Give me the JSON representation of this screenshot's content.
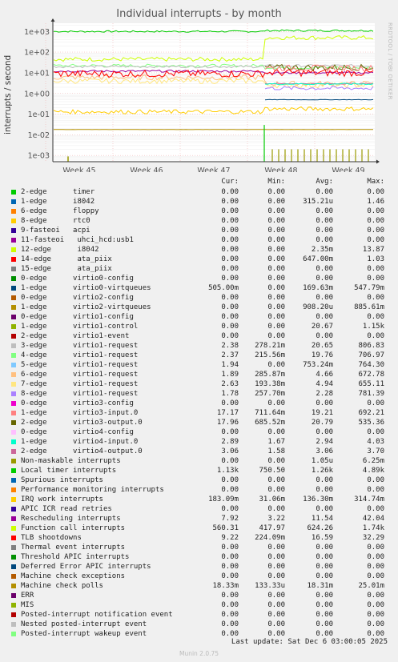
{
  "side_label": "RRDTOOL / TOBI OETIKER",
  "version": "Munin 2.0.75",
  "last_update": "Last update: Sat Dec  6 03:00:05 2025",
  "legend_headers": [
    "Cur:",
    "Min:",
    "Avg:",
    "Max:"
  ],
  "chart_data": {
    "type": "line",
    "title": "Individual interrupts - by month",
    "ylabel": "interrupts / second",
    "yscale": "log",
    "ylim": [
      0.0005,
      2500
    ],
    "yticks": [
      "1e+03",
      "1e+02",
      "1e+01",
      "1e+00",
      "1e-01",
      "1e-02",
      "1e-03"
    ],
    "x_tick_labels": [
      "Week 45",
      "Week 46",
      "Week 47",
      "Week 48",
      "Week 49"
    ],
    "grid": true,
    "series": [
      {
        "name": "2-edge      timer",
        "color": "#00cc00",
        "cur": "0.00",
        "min": "0.00",
        "avg": "0.00",
        "max": "0.00"
      },
      {
        "name": "1-edge      i8042",
        "color": "#0066b3",
        "cur": "0.00",
        "min": "0.00",
        "avg": "315.21u",
        "max": "1.46"
      },
      {
        "name": "6-edge      floppy",
        "color": "#ff8000",
        "cur": "0.00",
        "min": "0.00",
        "avg": "0.00",
        "max": "0.00"
      },
      {
        "name": "8-edge      rtc0",
        "color": "#ffcc00",
        "cur": "0.00",
        "min": "0.00",
        "avg": "0.00",
        "max": "0.00"
      },
      {
        "name": "9-fasteoi   acpi",
        "color": "#330099",
        "cur": "0.00",
        "min": "0.00",
        "avg": "0.00",
        "max": "0.00"
      },
      {
        "name": "11-fasteoi   uhci_hcd:usb1",
        "color": "#990099",
        "cur": "0.00",
        "min": "0.00",
        "avg": "0.00",
        "max": "0.00"
      },
      {
        "name": "12-edge      i8042",
        "color": "#ccff00",
        "cur": "0.00",
        "min": "0.00",
        "avg": "2.35m",
        "max": "13.87"
      },
      {
        "name": "14-edge      ata_piix",
        "color": "#ff0000",
        "cur": "0.00",
        "min": "0.00",
        "avg": "647.00m",
        "max": "1.03"
      },
      {
        "name": "15-edge      ata_piix",
        "color": "#808080",
        "cur": "0.00",
        "min": "0.00",
        "avg": "0.00",
        "max": "0.00"
      },
      {
        "name": "0-edge      virtio0-config",
        "color": "#008f00",
        "cur": "0.00",
        "min": "0.00",
        "avg": "0.00",
        "max": "0.00"
      },
      {
        "name": "1-edge      virtio0-virtqueues",
        "color": "#00487d",
        "cur": "505.00m",
        "min": "0.00",
        "avg": "169.63m",
        "max": "547.79m"
      },
      {
        "name": "0-edge      virtio2-config",
        "color": "#b35a00",
        "cur": "0.00",
        "min": "0.00",
        "avg": "0.00",
        "max": "0.00"
      },
      {
        "name": "1-edge      virtio2-virtqueues",
        "color": "#b38f00",
        "cur": "0.00",
        "min": "0.00",
        "avg": "908.20u",
        "max": "885.61m"
      },
      {
        "name": "0-edge      virtio1-config",
        "color": "#6b006b",
        "cur": "0.00",
        "min": "0.00",
        "avg": "0.00",
        "max": "0.00"
      },
      {
        "name": "1-edge      virtio1-control",
        "color": "#8fb300",
        "cur": "0.00",
        "min": "0.00",
        "avg": "20.67",
        "max": "1.15k"
      },
      {
        "name": "2-edge      virtio1-event",
        "color": "#b30000",
        "cur": "0.00",
        "min": "0.00",
        "avg": "0.00",
        "max": "0.00"
      },
      {
        "name": "3-edge      virtio1-request",
        "color": "#bebebe",
        "cur": "2.38",
        "min": "278.21m",
        "avg": "20.65",
        "max": "806.83"
      },
      {
        "name": "4-edge      virtio1-request",
        "color": "#80ff80",
        "cur": "2.37",
        "min": "215.56m",
        "avg": "19.76",
        "max": "706.97"
      },
      {
        "name": "5-edge      virtio1-request",
        "color": "#80c9ff",
        "cur": "1.94",
        "min": "0.00",
        "avg": "753.24m",
        "max": "764.30"
      },
      {
        "name": "6-edge      virtio1-request",
        "color": "#ffc080",
        "cur": "1.89",
        "min": "285.87m",
        "avg": "4.66",
        "max": "672.78"
      },
      {
        "name": "7-edge      virtio1-request",
        "color": "#ffe680",
        "cur": "2.63",
        "min": "193.38m",
        "avg": "4.94",
        "max": "655.11"
      },
      {
        "name": "8-edge      virtio1-request",
        "color": "#aa80ff",
        "cur": "1.78",
        "min": "257.70m",
        "avg": "2.28",
        "max": "781.39"
      },
      {
        "name": "0-edge      virtio3-config",
        "color": "#ee00cc",
        "cur": "0.00",
        "min": "0.00",
        "avg": "0.00",
        "max": "0.00"
      },
      {
        "name": "1-edge      virtio3-input.0",
        "color": "#ff8080",
        "cur": "17.17",
        "min": "711.64m",
        "avg": "19.21",
        "max": "692.21"
      },
      {
        "name": "2-edge      virtio3-output.0",
        "color": "#666600",
        "cur": "17.96",
        "min": "685.52m",
        "avg": "20.79",
        "max": "535.36"
      },
      {
        "name": "0-edge      virtio4-config",
        "color": "#ffbfff",
        "cur": "0.00",
        "min": "0.00",
        "avg": "0.00",
        "max": "0.00"
      },
      {
        "name": "1-edge      virtio4-input.0",
        "color": "#00ffcc",
        "cur": "2.89",
        "min": "1.67",
        "avg": "2.94",
        "max": "4.03"
      },
      {
        "name": "2-edge      virtio4-output.0",
        "color": "#cc6699",
        "cur": "3.06",
        "min": "1.58",
        "avg": "3.06",
        "max": "3.70"
      },
      {
        "name": "Non-maskable interrupts",
        "color": "#999900",
        "cur": "0.00",
        "min": "0.00",
        "avg": "1.05u",
        "max": "6.25m"
      },
      {
        "name": "Local timer interrupts",
        "color": "#00cc00",
        "cur": "1.13k",
        "min": "750.50",
        "avg": "1.26k",
        "max": "4.89k"
      },
      {
        "name": "Spurious interrupts",
        "color": "#0066b3",
        "cur": "0.00",
        "min": "0.00",
        "avg": "0.00",
        "max": "0.00"
      },
      {
        "name": "Performance monitoring interrupts",
        "color": "#ff8000",
        "cur": "0.00",
        "min": "0.00",
        "avg": "0.00",
        "max": "0.00"
      },
      {
        "name": "IRQ work interrupts",
        "color": "#ffcc00",
        "cur": "183.09m",
        "min": "31.06m",
        "avg": "136.30m",
        "max": "314.74m"
      },
      {
        "name": "APIC ICR read retries",
        "color": "#330099",
        "cur": "0.00",
        "min": "0.00",
        "avg": "0.00",
        "max": "0.00"
      },
      {
        "name": "Rescheduling interrupts",
        "color": "#990099",
        "cur": "7.92",
        "min": "3.22",
        "avg": "11.54",
        "max": "42.04"
      },
      {
        "name": "Function call interrupts",
        "color": "#ccff00",
        "cur": "560.31",
        "min": "417.97",
        "avg": "624.26",
        "max": "1.74k"
      },
      {
        "name": "TLB shootdowns",
        "color": "#ff0000",
        "cur": "9.22",
        "min": "224.09m",
        "avg": "16.59",
        "max": "32.29"
      },
      {
        "name": "Thermal event interrupts",
        "color": "#808080",
        "cur": "0.00",
        "min": "0.00",
        "avg": "0.00",
        "max": "0.00"
      },
      {
        "name": "Threshold APIC interrupts",
        "color": "#008f00",
        "cur": "0.00",
        "min": "0.00",
        "avg": "0.00",
        "max": "0.00"
      },
      {
        "name": "Deferred Error APIC interrupts",
        "color": "#00487d",
        "cur": "0.00",
        "min": "0.00",
        "avg": "0.00",
        "max": "0.00"
      },
      {
        "name": "Machine check exceptions",
        "color": "#b35a00",
        "cur": "0.00",
        "min": "0.00",
        "avg": "0.00",
        "max": "0.00"
      },
      {
        "name": "Machine check polls",
        "color": "#b38f00",
        "cur": "18.33m",
        "min": "133.33u",
        "avg": "18.31m",
        "max": "25.01m"
      },
      {
        "name": "ERR",
        "color": "#6b006b",
        "cur": "0.00",
        "min": "0.00",
        "avg": "0.00",
        "max": "0.00"
      },
      {
        "name": "MIS",
        "color": "#8fb300",
        "cur": "0.00",
        "min": "0.00",
        "avg": "0.00",
        "max": "0.00"
      },
      {
        "name": "Posted-interrupt notification event",
        "color": "#b30000",
        "cur": "0.00",
        "min": "0.00",
        "avg": "0.00",
        "max": "0.00"
      },
      {
        "name": "Nested posted-interrupt event",
        "color": "#bebebe",
        "cur": "0.00",
        "min": "0.00",
        "avg": "0.00",
        "max": "0.00"
      },
      {
        "name": "Posted-interrupt wakeup event",
        "color": "#80ff80",
        "cur": "0.00",
        "min": "0.00",
        "avg": "0.00",
        "max": "0.00"
      }
    ],
    "lines": [
      {
        "color": "#00cc00",
        "before": 1000,
        "after": 1100,
        "noise": 0.08
      },
      {
        "color": "#ccff00",
        "before": 45,
        "after": 500,
        "noise": 0.2
      },
      {
        "color": "#80ff80",
        "before": 22,
        "after": 18,
        "noise": 0.15
      },
      {
        "color": "#bebebe",
        "before": 20,
        "after": 22,
        "noise": 0.12
      },
      {
        "color": "#990099",
        "before": 12,
        "after": 10,
        "noise": 0.1
      },
      {
        "color": "#ffc080",
        "before": 6,
        "after": 3,
        "noise": 0.25
      },
      {
        "color": "#ffe680",
        "before": 4,
        "after": 2.5,
        "noise": 0.25
      },
      {
        "color": "#ff0000",
        "before": 9,
        "after": 10,
        "noise": 0.35
      },
      {
        "color": "#666600",
        "before": 0,
        "after": 18,
        "noise": 0.3
      },
      {
        "color": "#ff8080",
        "before": 0,
        "after": 17,
        "noise": 0.3
      },
      {
        "color": "#cc6699",
        "before": 0,
        "after": 3,
        "noise": 0.05
      },
      {
        "color": "#00ffcc",
        "before": 0,
        "after": 2.9,
        "noise": 0.08
      },
      {
        "color": "#aa80ff",
        "before": 0,
        "after": 1.8,
        "noise": 0.2
      },
      {
        "color": "#00487d",
        "before": 0,
        "after": 0.5,
        "noise": 0.02
      },
      {
        "color": "#ffcc00",
        "before": 0.13,
        "after": 0.18,
        "noise": 0.2
      },
      {
        "color": "#b38f00",
        "before": 0.018,
        "after": 0.018,
        "noise": 0.01
      }
    ]
  }
}
